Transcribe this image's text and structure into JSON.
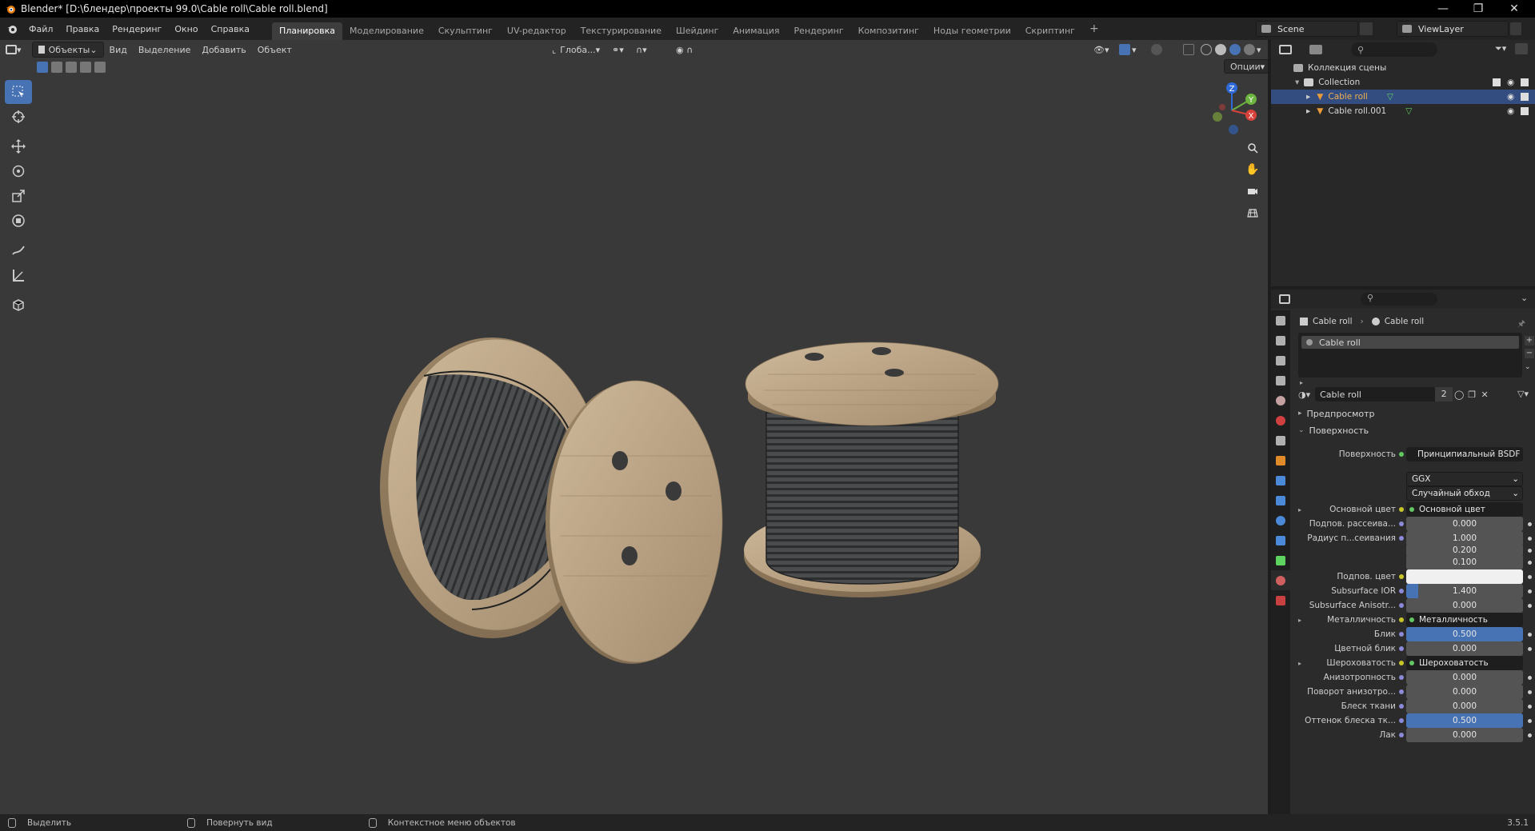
{
  "window": {
    "title": "Blender* [D:\\блендер\\проекты 99.0\\Cable roll\\Cable roll.blend]",
    "minimize_icon": "minimize-icon",
    "maximize_icon": "restore-icon",
    "close_icon": "close-icon"
  },
  "menu": [
    "Файл",
    "Правка",
    "Рендеринг",
    "Окно",
    "Справка"
  ],
  "workspaces": [
    "Планировка",
    "Моделирование",
    "Скульптинг",
    "UV-редактор",
    "Текстурирование",
    "Шейдинг",
    "Анимация",
    "Рендеринг",
    "Композитинг",
    "Ноды геометрии",
    "Скриптинг"
  ],
  "active_workspace_index": 0,
  "add_workspace_label": "+",
  "scene": {
    "name": "Scene",
    "view_layer": "ViewLayer"
  },
  "viewport": {
    "mode": "Объекты",
    "menus": [
      "Вид",
      "Выделение",
      "Добавить",
      "Объект"
    ],
    "orientation": "Глоба...",
    "options_label": "Опции",
    "gizmo_labels": {
      "z": "Z",
      "y": "Y",
      "x": "X"
    }
  },
  "outliner": {
    "root": "Коллекция сцены",
    "collection": "Collection",
    "items": [
      {
        "name": "Cable roll",
        "selected": true
      },
      {
        "name": "Cable roll.001",
        "selected": false
      }
    ]
  },
  "properties": {
    "breadcrumb": [
      "Cable roll",
      "Cable roll"
    ],
    "material_slot": "Cable roll",
    "material_name": "Cable roll",
    "material_users": "2",
    "panels": {
      "preview": "Предпросмотр",
      "surface": "Поверхность"
    },
    "surface": {
      "label": "Поверхность",
      "shader": "Принципиальный BSDF",
      "distribution": "GGX",
      "subsurface_method": "Случайный обход"
    },
    "rows": [
      {
        "label": "Основной цвет",
        "value": "Основной цвет",
        "kind": "link",
        "expand": true
      },
      {
        "label": "Подпов. рассеива...",
        "value": "0.000",
        "kind": "num",
        "fill": 0
      },
      {
        "label": "Радиус п...сеивания",
        "value": "1.000",
        "kind": "num",
        "fill": 0
      },
      {
        "label": "",
        "value": "0.200",
        "kind": "num",
        "fill": 0
      },
      {
        "label": "",
        "value": "0.100",
        "kind": "num",
        "fill": 0
      },
      {
        "label": "Подпов. цвет",
        "value": "",
        "kind": "color"
      },
      {
        "label": "Subsurface IOR",
        "value": "1.400",
        "kind": "num",
        "fill": 0.1
      },
      {
        "label": "Subsurface Anisotr...",
        "value": "0.000",
        "kind": "num",
        "fill": 0
      },
      {
        "label": "Металличность",
        "value": "Металличность",
        "kind": "link",
        "expand": true
      },
      {
        "label": "Блик",
        "value": "0.500",
        "kind": "num",
        "fill": 1
      },
      {
        "label": "Цветной блик",
        "value": "0.000",
        "kind": "num",
        "fill": 0
      },
      {
        "label": "Шероховатость",
        "value": "Шероховатость",
        "kind": "link",
        "expand": true
      },
      {
        "label": "Анизотропность",
        "value": "0.000",
        "kind": "num",
        "fill": 0
      },
      {
        "label": "Поворот анизотро...",
        "value": "0.000",
        "kind": "num",
        "fill": 0
      },
      {
        "label": "Блеск ткани",
        "value": "0.000",
        "kind": "num",
        "fill": 0
      },
      {
        "label": "Оттенок блеска тк...",
        "value": "0.500",
        "kind": "num",
        "fill": 1
      },
      {
        "label": "Лак",
        "value": "0.000",
        "kind": "num",
        "fill": 0
      }
    ]
  },
  "statusbar": {
    "items": [
      "Выделить",
      "Повернуть вид",
      "Контекстное меню объектов"
    ],
    "version": "3.5.1"
  },
  "colors": {
    "accent": "#4772b3",
    "viewport_bg": "#393939",
    "selected_row": "#334d80"
  }
}
